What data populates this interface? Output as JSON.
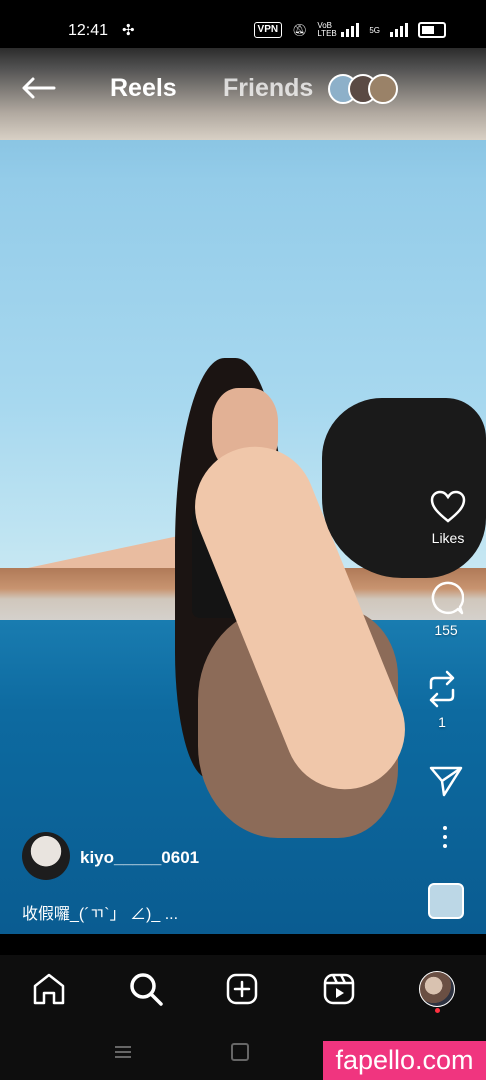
{
  "status_bar": {
    "time": "12:41",
    "vpn": "VPN",
    "network_a": "VoB LTEB",
    "network_b": "5G"
  },
  "header": {
    "back_icon": "arrow-left-icon",
    "tab_reels": "Reels",
    "tab_friends": "Friends"
  },
  "actions": {
    "likes_label": "Likes",
    "comments_count": "155",
    "reposts_count": "1"
  },
  "reel": {
    "username": "kiyo_____0601",
    "caption": "收假囉_(´ㄲ`」 ∠)_ ..."
  },
  "nav": {
    "items": [
      "home-icon",
      "search-icon",
      "create-icon",
      "reels-icon",
      "profile-avatar"
    ]
  },
  "watermark": "fapello.com",
  "colors": {
    "accent_red": "#ff3040",
    "watermark_pink": "#f0357f"
  }
}
